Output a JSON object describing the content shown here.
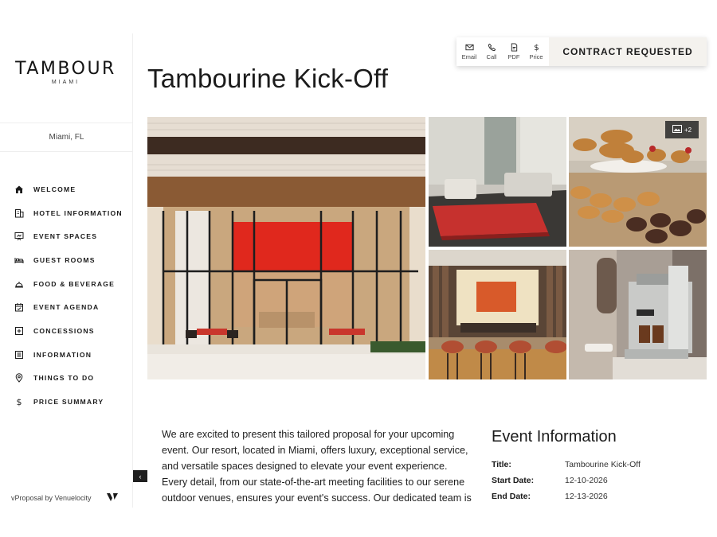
{
  "brand": {
    "name": "TAMBOUR",
    "sub": "MIAMI"
  },
  "location": "Miami, FL",
  "nav": [
    {
      "label": "WELCOME",
      "icon": "home-icon"
    },
    {
      "label": "HOTEL INFORMATION",
      "icon": "building-icon"
    },
    {
      "label": "EVENT SPACES",
      "icon": "presentation-icon"
    },
    {
      "label": "GUEST ROOMS",
      "icon": "bed-icon"
    },
    {
      "label": "FOOD & BEVERAGE",
      "icon": "cloche-icon"
    },
    {
      "label": "EVENT AGENDA",
      "icon": "calendar-icon"
    },
    {
      "label": "CONCESSIONS",
      "icon": "plus-square-icon"
    },
    {
      "label": "INFORMATION",
      "icon": "document-list-icon"
    },
    {
      "label": "THINGS TO DO",
      "icon": "map-pin-icon"
    },
    {
      "label": "PRICE SUMMARY",
      "icon": "dollar-icon"
    }
  ],
  "footer": {
    "text": "vProposal by Venuelocity"
  },
  "toolbar": {
    "email": "Email",
    "call": "Call",
    "pdf": "PDF",
    "price": "Price",
    "contract": "CONTRACT REQUESTED"
  },
  "title": "Tambourine Kick-Off",
  "gallery": {
    "more_count": "+2"
  },
  "intro": "We are excited to present this tailored proposal for your upcoming event. Our resort, located in Miami, offers luxury, exceptional service, and versatile spaces designed to elevate your event experience. Every detail, from our state-of-the-art meeting facilities to our serene outdoor venues, ensures your event's success. Our dedicated team is",
  "event_info": {
    "heading": "Event Information",
    "title_label": "Title:",
    "title_value": "Tambourine Kick-Off",
    "start_label": "Start Date:",
    "start_value": "12-10-2026",
    "end_label": "End Date:",
    "end_value": "12-13-2026"
  },
  "colors": {
    "accent_red": "#d8231c",
    "dark": "#1f1f1f",
    "toolbar_bg": "#f4f2ee"
  }
}
